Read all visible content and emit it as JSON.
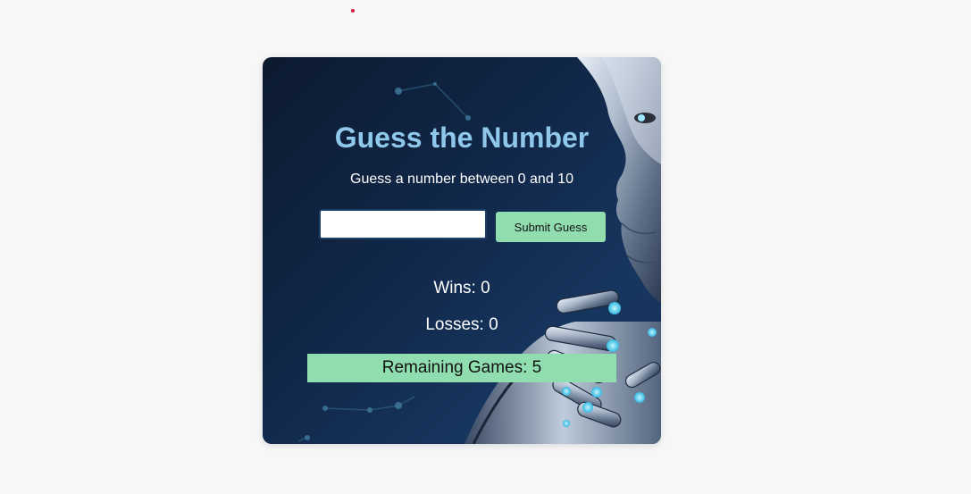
{
  "game": {
    "title": "Guess the Number",
    "subtitle": "Guess a number between 0 and 10",
    "input": {
      "value": "",
      "placeholder": ""
    },
    "submit_label": "Submit Guess",
    "wins_label": "Wins: 0",
    "losses_label": "Losses: 0",
    "remaining_label": "Remaining Games: 5"
  },
  "colors": {
    "page_background": "#f7f7f8",
    "card_background": "#11284a",
    "title_color": "#8fc8ea",
    "accent_green": "#90deb0",
    "indicator_dot": "#d81b3c"
  },
  "icons": {
    "background": "robot-face-illustration"
  }
}
